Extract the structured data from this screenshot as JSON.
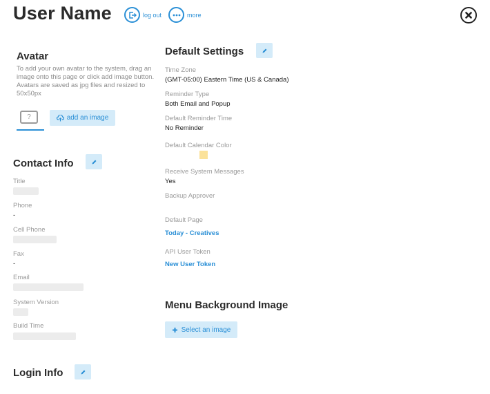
{
  "header": {
    "title": "User Name",
    "logout_label": "log out",
    "more_label": "more"
  },
  "avatar": {
    "heading": "Avatar",
    "description": "To add your own avatar to the system, drag an image onto this page or click add image button. Avatars are saved as jpg files and resized to 50x50px",
    "placeholder_glyph": "?",
    "add_image_label": "add an image"
  },
  "contact_info": {
    "heading": "Contact Info",
    "fields": [
      {
        "label": "Title",
        "value": ""
      },
      {
        "label": "Phone",
        "value": "-"
      },
      {
        "label": "Cell Phone",
        "value": ""
      },
      {
        "label": "Fax",
        "value": "-"
      },
      {
        "label": "Email",
        "value": ""
      },
      {
        "label": "System Version",
        "value": ""
      },
      {
        "label": "Build Time",
        "value": ""
      }
    ]
  },
  "login_info": {
    "heading": "Login Info"
  },
  "default_settings": {
    "heading": "Default Settings",
    "time_zone_label": "Time Zone",
    "time_zone_value": "(GMT-05:00) Eastern Time (US & Canada)",
    "reminder_type_label": "Reminder Type",
    "reminder_type_value": "Both Email and Popup",
    "default_reminder_time_label": "Default Reminder Time",
    "default_reminder_time_value": "No Reminder",
    "default_calendar_color_label": "Default Calendar Color",
    "default_calendar_color": "#fbe29a",
    "receive_system_messages_label": "Receive System Messages",
    "receive_system_messages_value": "Yes",
    "backup_approver_label": "Backup Approver",
    "default_page_label": "Default Page",
    "default_page_value": "Today - Creatives",
    "api_user_token_label": "API User Token",
    "api_user_token_value": "New User Token"
  },
  "menu_background": {
    "heading": "Menu Background Image",
    "select_label": "Select an image"
  },
  "colors": {
    "accent": "#2a8fd6",
    "button_bg": "#d4ebf9",
    "text_dark": "#2b2b2b",
    "text_muted": "#9a9a9a"
  },
  "icons": [
    "logout-icon",
    "more-icon",
    "close-icon",
    "pencil-icon",
    "upload-cloud-icon",
    "plus-icon"
  ]
}
